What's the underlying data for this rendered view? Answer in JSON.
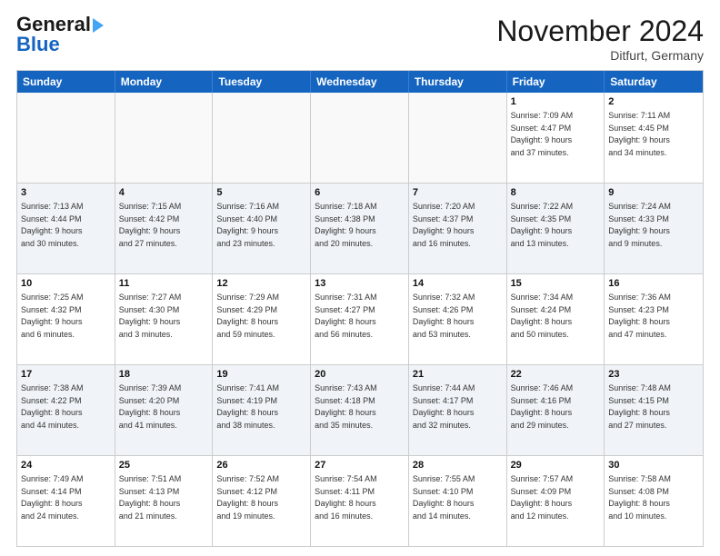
{
  "logo": {
    "line1": "General",
    "line2": "Blue"
  },
  "title": "November 2024",
  "location": "Ditfurt, Germany",
  "days": [
    "Sunday",
    "Monday",
    "Tuesday",
    "Wednesday",
    "Thursday",
    "Friday",
    "Saturday"
  ],
  "rows": [
    [
      {
        "day": "",
        "info": ""
      },
      {
        "day": "",
        "info": ""
      },
      {
        "day": "",
        "info": ""
      },
      {
        "day": "",
        "info": ""
      },
      {
        "day": "",
        "info": ""
      },
      {
        "day": "1",
        "info": "Sunrise: 7:09 AM\nSunset: 4:47 PM\nDaylight: 9 hours\nand 37 minutes."
      },
      {
        "day": "2",
        "info": "Sunrise: 7:11 AM\nSunset: 4:45 PM\nDaylight: 9 hours\nand 34 minutes."
      }
    ],
    [
      {
        "day": "3",
        "info": "Sunrise: 7:13 AM\nSunset: 4:44 PM\nDaylight: 9 hours\nand 30 minutes."
      },
      {
        "day": "4",
        "info": "Sunrise: 7:15 AM\nSunset: 4:42 PM\nDaylight: 9 hours\nand 27 minutes."
      },
      {
        "day": "5",
        "info": "Sunrise: 7:16 AM\nSunset: 4:40 PM\nDaylight: 9 hours\nand 23 minutes."
      },
      {
        "day": "6",
        "info": "Sunrise: 7:18 AM\nSunset: 4:38 PM\nDaylight: 9 hours\nand 20 minutes."
      },
      {
        "day": "7",
        "info": "Sunrise: 7:20 AM\nSunset: 4:37 PM\nDaylight: 9 hours\nand 16 minutes."
      },
      {
        "day": "8",
        "info": "Sunrise: 7:22 AM\nSunset: 4:35 PM\nDaylight: 9 hours\nand 13 minutes."
      },
      {
        "day": "9",
        "info": "Sunrise: 7:24 AM\nSunset: 4:33 PM\nDaylight: 9 hours\nand 9 minutes."
      }
    ],
    [
      {
        "day": "10",
        "info": "Sunrise: 7:25 AM\nSunset: 4:32 PM\nDaylight: 9 hours\nand 6 minutes."
      },
      {
        "day": "11",
        "info": "Sunrise: 7:27 AM\nSunset: 4:30 PM\nDaylight: 9 hours\nand 3 minutes."
      },
      {
        "day": "12",
        "info": "Sunrise: 7:29 AM\nSunset: 4:29 PM\nDaylight: 8 hours\nand 59 minutes."
      },
      {
        "day": "13",
        "info": "Sunrise: 7:31 AM\nSunset: 4:27 PM\nDaylight: 8 hours\nand 56 minutes."
      },
      {
        "day": "14",
        "info": "Sunrise: 7:32 AM\nSunset: 4:26 PM\nDaylight: 8 hours\nand 53 minutes."
      },
      {
        "day": "15",
        "info": "Sunrise: 7:34 AM\nSunset: 4:24 PM\nDaylight: 8 hours\nand 50 minutes."
      },
      {
        "day": "16",
        "info": "Sunrise: 7:36 AM\nSunset: 4:23 PM\nDaylight: 8 hours\nand 47 minutes."
      }
    ],
    [
      {
        "day": "17",
        "info": "Sunrise: 7:38 AM\nSunset: 4:22 PM\nDaylight: 8 hours\nand 44 minutes."
      },
      {
        "day": "18",
        "info": "Sunrise: 7:39 AM\nSunset: 4:20 PM\nDaylight: 8 hours\nand 41 minutes."
      },
      {
        "day": "19",
        "info": "Sunrise: 7:41 AM\nSunset: 4:19 PM\nDaylight: 8 hours\nand 38 minutes."
      },
      {
        "day": "20",
        "info": "Sunrise: 7:43 AM\nSunset: 4:18 PM\nDaylight: 8 hours\nand 35 minutes."
      },
      {
        "day": "21",
        "info": "Sunrise: 7:44 AM\nSunset: 4:17 PM\nDaylight: 8 hours\nand 32 minutes."
      },
      {
        "day": "22",
        "info": "Sunrise: 7:46 AM\nSunset: 4:16 PM\nDaylight: 8 hours\nand 29 minutes."
      },
      {
        "day": "23",
        "info": "Sunrise: 7:48 AM\nSunset: 4:15 PM\nDaylight: 8 hours\nand 27 minutes."
      }
    ],
    [
      {
        "day": "24",
        "info": "Sunrise: 7:49 AM\nSunset: 4:14 PM\nDaylight: 8 hours\nand 24 minutes."
      },
      {
        "day": "25",
        "info": "Sunrise: 7:51 AM\nSunset: 4:13 PM\nDaylight: 8 hours\nand 21 minutes."
      },
      {
        "day": "26",
        "info": "Sunrise: 7:52 AM\nSunset: 4:12 PM\nDaylight: 8 hours\nand 19 minutes."
      },
      {
        "day": "27",
        "info": "Sunrise: 7:54 AM\nSunset: 4:11 PM\nDaylight: 8 hours\nand 16 minutes."
      },
      {
        "day": "28",
        "info": "Sunrise: 7:55 AM\nSunset: 4:10 PM\nDaylight: 8 hours\nand 14 minutes."
      },
      {
        "day": "29",
        "info": "Sunrise: 7:57 AM\nSunset: 4:09 PM\nDaylight: 8 hours\nand 12 minutes."
      },
      {
        "day": "30",
        "info": "Sunrise: 7:58 AM\nSunset: 4:08 PM\nDaylight: 8 hours\nand 10 minutes."
      }
    ]
  ]
}
